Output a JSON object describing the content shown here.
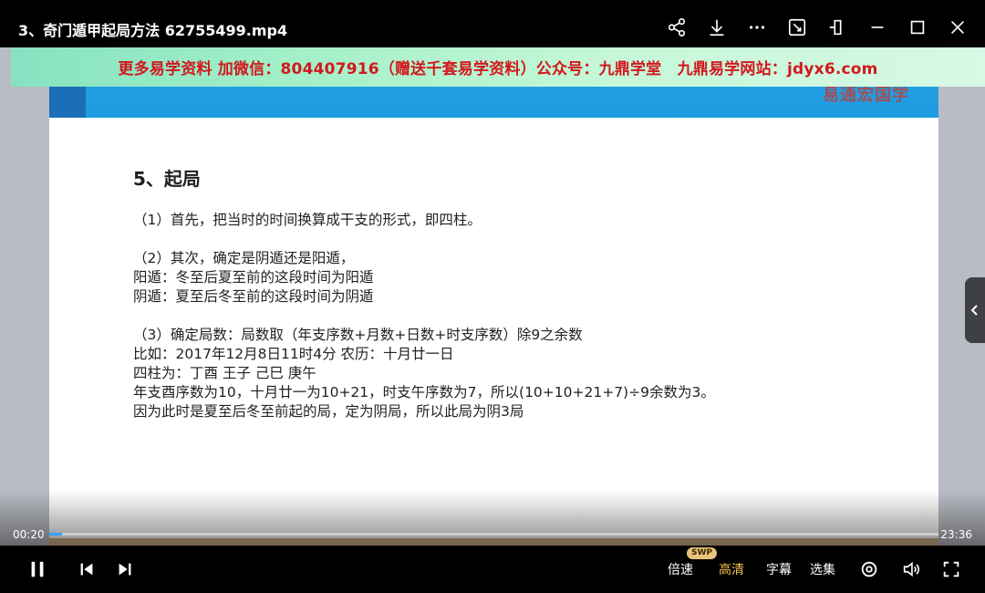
{
  "window": {
    "title": "3、奇门遁甲起局方法 62755499.mp4",
    "icons": [
      "share-icon",
      "download-icon",
      "more-icon",
      "pip-icon",
      "pin-icon",
      "minimize-icon",
      "maximize-icon",
      "close-icon"
    ]
  },
  "watermark": "更多易学资料 加微信：804407916（赠送千套易学资料）公众号：九鼎学堂　九鼎易学网站：jdyx6.com",
  "slide": {
    "logo": "易通宏国学",
    "heading": "5、起局",
    "lines": [
      "（1）首先，把当时的时间换算成干支的形式，即四柱。",
      "（2）其次，确定是阴遁还是阳遁，",
      "阳遁：冬至后夏至前的这段时间为阳遁",
      "阴遁：夏至后冬至前的这段时间为阴遁",
      "（3）确定局数：局数取（年支序数+月数+日数+时支序数）除9之余数",
      "比如：2017年12月8日11时4分 农历：十月廿一日",
      "四柱为：丁酉 王子 己巳 庚午",
      "年支酉序数为10，十月廿一为10+21，时支午序数为7，所以(10+10+21+7)÷9余数为3。",
      "因为此时是夏至后冬至前起的局，定为阴局，所以此局为阴3局"
    ]
  },
  "player": {
    "current_time": "00:20",
    "duration": "23:36",
    "progress": 0.014,
    "speed_label": "倍速",
    "swp_badge": "SWP",
    "quality_label": "高清",
    "subtitle_label": "字幕",
    "episodes_label": "选集",
    "accent_color": "#35a0ff",
    "quality_color": "#f6c34a"
  }
}
